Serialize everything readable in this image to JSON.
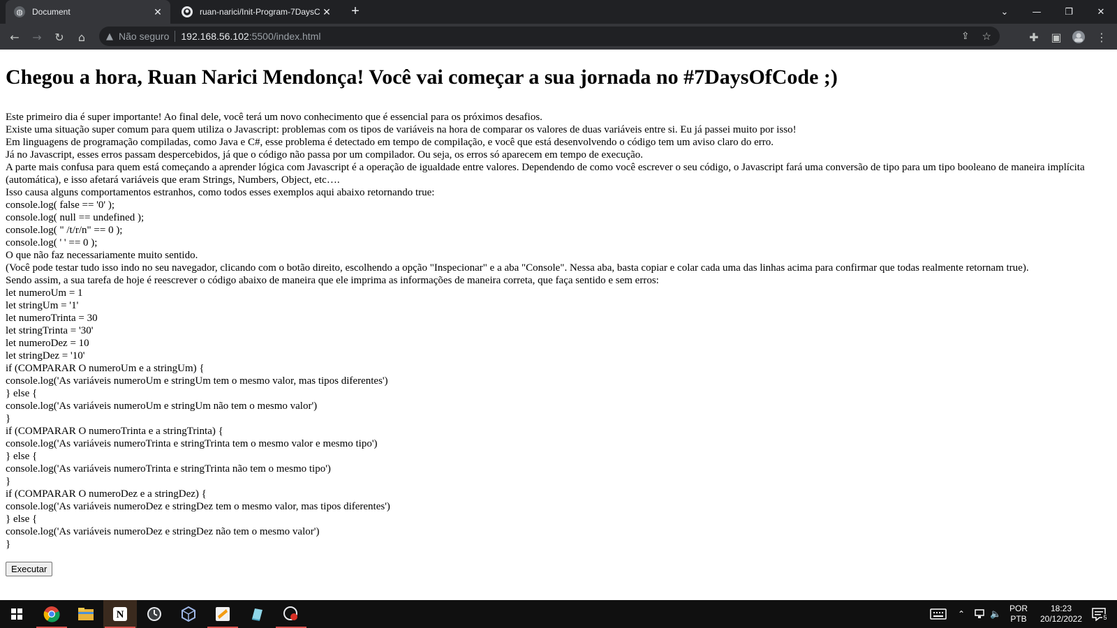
{
  "browser": {
    "tabs": [
      {
        "title": "Document",
        "active": true
      },
      {
        "title": "ruan-narici/Init-Program-7DaysC",
        "active": false
      }
    ],
    "new_tab_label": "+",
    "security_label": "Não seguro",
    "url_host": "192.168.56.102",
    "url_path": ":5500/index.html"
  },
  "page": {
    "heading": "Chegou a hora, Ruan Narici Mendonça! Você vai começar a sua jornada no #7DaysOfCode ;)",
    "lines": [
      "Este primeiro dia é super importante! Ao final dele, você terá um novo conhecimento que é essencial para os próximos desafios.",
      "Existe uma situação super comum para quem utiliza o Javascript: problemas com os tipos de variáveis na hora de comparar os valores de duas variáveis entre si. Eu já passei muito por isso!",
      "Em linguagens de programação compiladas, como Java e C#, esse problema é detectado em tempo de compilação, e você que está desenvolvendo o código tem um aviso claro do erro.",
      "Já no Javascript, esses erros passam despercebidos, já que o código não passa por um compilador. Ou seja, os erros só aparecem em tempo de execução.",
      "A parte mais confusa para quem está começando a aprender lógica com Javascript é a operação de igualdade entre valores. Dependendo de como você escrever o seu código, o Javascript fará uma conversão de tipo para um tipo booleano de maneira implícita (automática), e isso afetará variáveis que eram Strings, Numbers, Object, etc….",
      "Isso causa alguns comportamentos estranhos, como todos esses exemplos aqui abaixo retornando true:",
      "console.log( false == '0' );",
      "console.log( null == undefined );",
      "console.log( \" /t/r/n\" == 0 );",
      "console.log( ' ' == 0 );",
      "O que não faz necessariamente muito sentido.",
      "(Você pode testar tudo isso indo no seu navegador, clicando com o botão direito, escolhendo a opção \"Inspecionar\" e a aba \"Console\". Nessa aba, basta copiar e colar cada uma das linhas acima para confirmar que todas realmente retornam true).",
      "Sendo assim, a sua tarefa de hoje é reescrever o código abaixo de maneira que ele imprima as informações de maneira correta, que faça sentido e sem erros:",
      "let numeroUm = 1",
      "let stringUm = '1'",
      "let numeroTrinta = 30",
      "let stringTrinta = '30'",
      "let numeroDez = 10",
      "let stringDez = '10'",
      "if (COMPARAR O numeroUm e a stringUm) {",
      "console.log('As variáveis numeroUm e stringUm tem o mesmo valor, mas tipos diferentes')",
      "} else {",
      "console.log('As variáveis numeroUm e stringUm não tem o mesmo valor')",
      "}",
      "if (COMPARAR O numeroTrinta e a stringTrinta) {",
      "console.log('As variáveis numeroTrinta e stringTrinta tem o mesmo valor e mesmo tipo')",
      "} else {",
      "console.log('As variáveis numeroTrinta e stringTrinta não tem o mesmo tipo')",
      "}",
      "if (COMPARAR O numeroDez e a stringDez) {",
      "console.log('As variáveis numeroDez e stringDez tem o mesmo valor, mas tipos diferentes')",
      "} else {",
      "console.log('As variáveis numeroDez e stringDez não tem o mesmo valor')",
      "}"
    ],
    "button_label": "Executar"
  },
  "taskbar": {
    "language": "POR",
    "layout": "PTB",
    "time": "18:23",
    "date": "20/12/2022",
    "notification_count": "5"
  },
  "colors": {
    "tabbar": "#202124",
    "toolbar": "#35363a",
    "taskbar": "#101010"
  }
}
